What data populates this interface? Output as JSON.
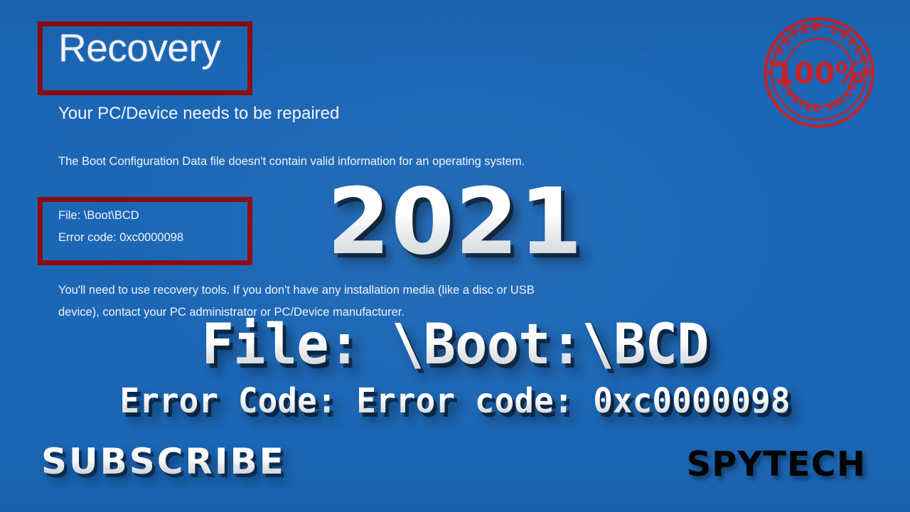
{
  "screen": {
    "background_color": "#1b66b5",
    "annotation_box_color": "#8c0b0e"
  },
  "recovery": {
    "title": "Recovery",
    "subtitle": "Your PC/Device needs to be repaired",
    "problem_statement": "The Boot Configuration Data file doesn't contain valid information for an operating system.",
    "details": {
      "file_label": "File: \\Boot\\BCD",
      "error_code_label": "Error code: 0xc0000098"
    },
    "advice_line_1": "You'll need to use recovery tools. If you don't have any installation media (like a disc or USB",
    "advice_line_2": "device), contact your PC administrator or PC/Device manufacturer."
  },
  "stamp": {
    "top_arc_text": "TRUSTED SELLER",
    "bottom_arc_text": "TRUSTED SELLER",
    "center_text": "100%",
    "color": "#d81f1f"
  },
  "overlay": {
    "year": "2021",
    "file_headline": "File: \\Boot:\\BCD",
    "error_headline": "Error Code: Error code: 0xc0000098",
    "subscribe": "SUBSCRIBE",
    "brand": "SPYTECH"
  }
}
